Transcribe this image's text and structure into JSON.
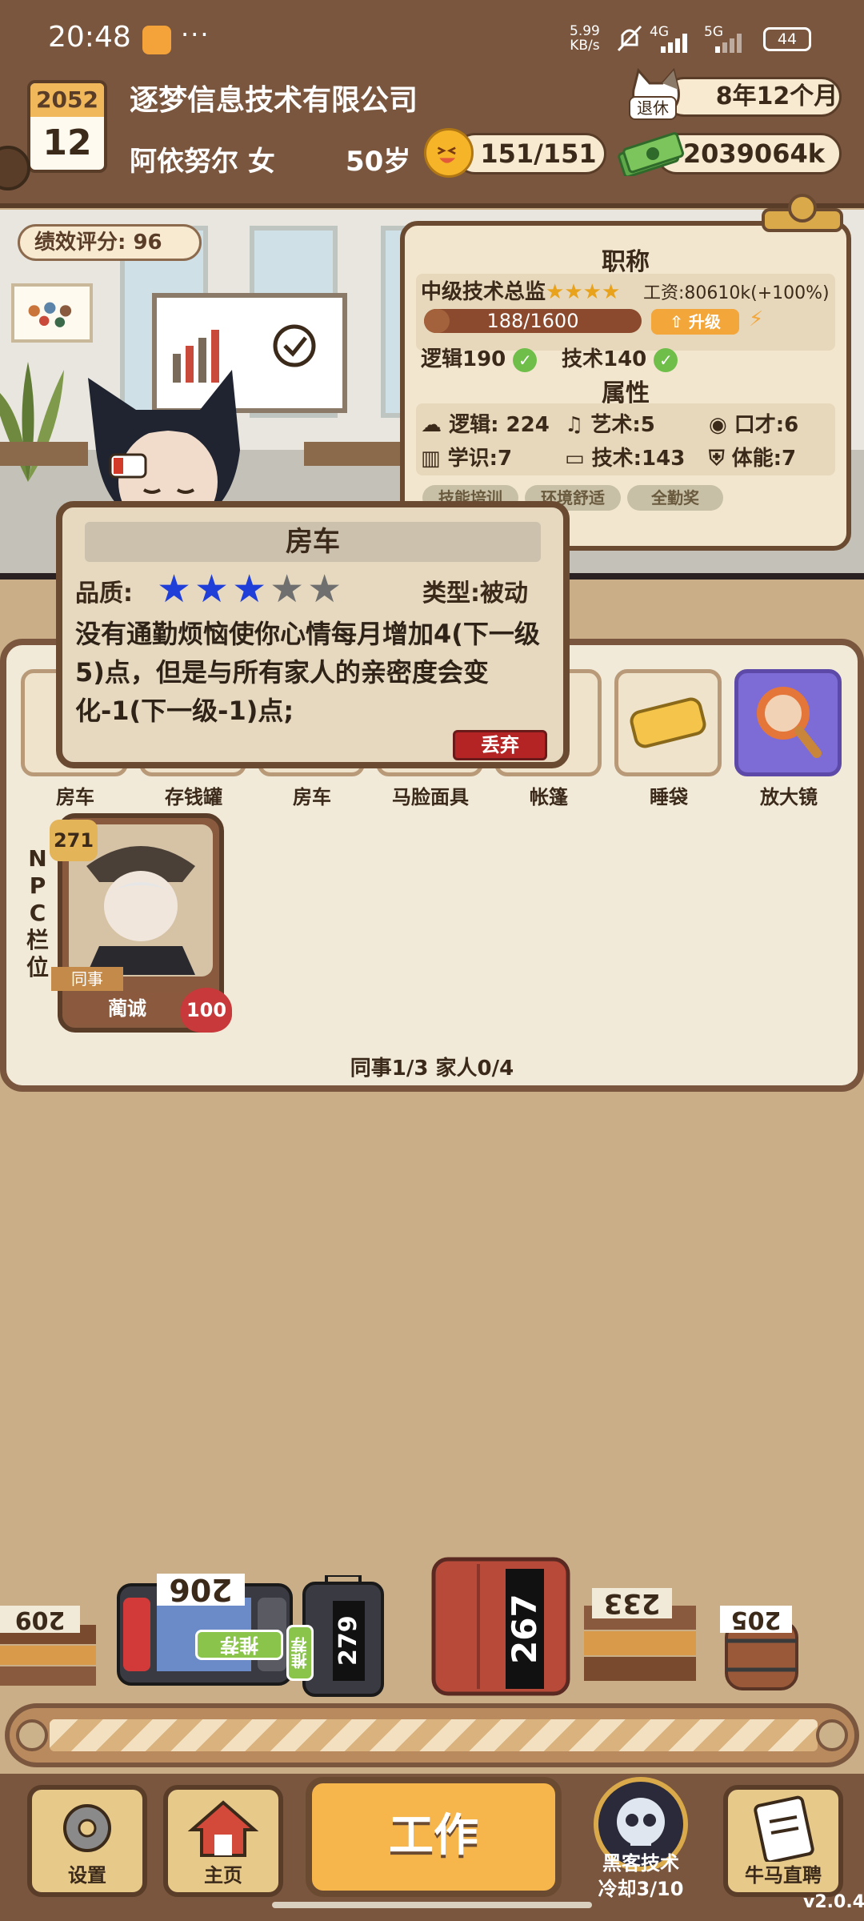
{
  "status_bar": {
    "time": "20:48",
    "net_speed_value": "5.99",
    "net_speed_unit": "KB/s",
    "sim1": "4G",
    "sim2": "5G",
    "battery": "44"
  },
  "header": {
    "year": "2052",
    "month": "12",
    "company": "逐梦信息技术有限公司",
    "player_name_gender": "阿依努尔 女",
    "age": "50岁",
    "energy": "151/151",
    "retire_label": "退休",
    "retire_countdown": "8年12个月",
    "money": "2039064k"
  },
  "office": {
    "performance_score": "绩效评分: 96"
  },
  "title_card": {
    "section_title": "职称",
    "job_title": "中级技术总监",
    "job_stars": "★★★★",
    "salary": "工资:80610k(+100%)",
    "progress": "188/1600",
    "progress_fraction": 0.1175,
    "upgrade_label": "升级",
    "req_logic": "逻辑190",
    "req_tech": "技术140",
    "attr_title": "属性",
    "attrs": {
      "logic": "逻辑: 224",
      "art": "艺术:5",
      "eloquence": "口才:6",
      "knowledge": "学识:7",
      "tech": "技术:143",
      "stamina": "体能:7"
    },
    "buffs": [
      "技能培训",
      "环境舒适",
      "全勤奖"
    ]
  },
  "popup": {
    "title": "房车",
    "quality_label": "品质:",
    "quality_stars": 3,
    "quality_max": 5,
    "type": "类型:被动",
    "description": "没有通勤烦恼使你心情每月增加4(下一级5)点，但是与所有家人的亲密度会变化-1(下一级-1)点;",
    "discard_label": "丢弃"
  },
  "inventory": {
    "items": [
      {
        "label": "房车",
        "icon": "rv-icon"
      },
      {
        "label": "存钱罐",
        "icon": "piggy-bank-icon"
      },
      {
        "label": "房车",
        "icon": "rv-icon"
      },
      {
        "label": "马脸面具",
        "icon": "horse-mask-icon"
      },
      {
        "label": "帐篷",
        "icon": "tent-icon"
      },
      {
        "label": "睡袋",
        "icon": "sleeping-bag-icon"
      },
      {
        "label": "放大镜",
        "icon": "magnifier-icon"
      }
    ],
    "npc_side_label": [
      "N",
      "P",
      "C",
      "栏",
      "位"
    ],
    "npc": {
      "level": "271",
      "tag": "同事",
      "name": "蔺诚",
      "affinity": "100"
    },
    "counts": "同事1/3 家人0/4"
  },
  "conveyor": {
    "items": [
      {
        "price": "209",
        "icon": "books-icon"
      },
      {
        "price": "206",
        "icon": "game-console-icon"
      },
      {
        "price": "279",
        "icon": "suitcase-icon",
        "badge": "推荐"
      },
      {
        "price": "267",
        "icon": "luggage-icon"
      },
      {
        "price": "233",
        "icon": "books-icon"
      },
      {
        "price": "205",
        "icon": "barrel-icon"
      }
    ],
    "recommend_label": "推荐"
  },
  "bottom_nav": {
    "settings": "设置",
    "home": "主页",
    "work": "工作",
    "hacker_name": "黑客技术",
    "hacker_cooldown": "冷却3/10",
    "recruit": "牛马直聘",
    "version": "v2.0.4"
  },
  "colors": {
    "wood": "#7a563e",
    "paper": "#f2e6cf",
    "star_filled": "#1f3fd8",
    "star_empty": "#6f6f6f",
    "discard": "#b52424"
  }
}
